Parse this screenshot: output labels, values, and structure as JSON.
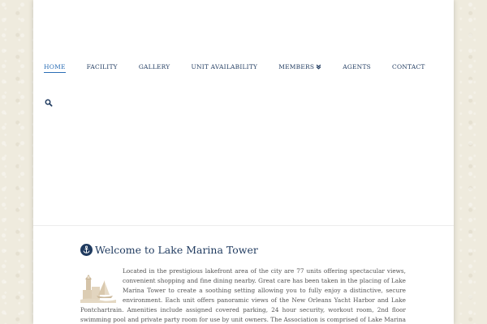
{
  "nav": {
    "items": [
      {
        "label": "HOME",
        "active": true
      },
      {
        "label": "FACILITY"
      },
      {
        "label": "GALLERY"
      },
      {
        "label": "UNIT AVAILABILITY"
      },
      {
        "label": "MEMBERS",
        "has_dropdown": true
      },
      {
        "label": "AGENTS"
      },
      {
        "label": "CONTACT"
      }
    ],
    "search_icon": "search-icon"
  },
  "welcome": {
    "title": "Welcome to Lake Marina Tower",
    "icon": "anchor-icon",
    "image": "lighthouse-logo",
    "body": "Located in the prestigious lakefront area of the city are 77 units offering spectacular views, convenient shopping and fine dining nearby. Great care has been taken in the placing of Lake Marina Tower to create a soothing setting allowing you to fully enjoy a distinctive, secure environment. Each unit offers panoramic views of the New Orleans Yacht Harbor and Lake Pontchartrain. Amenities include assigned covered parking, 24 hour security, workout room, 2nd floor swimming pool and private party room for use by unit owners. The Association is comprised of Lake Marina Tower owners who annually elect a Board of Directors"
  },
  "colors": {
    "navy": "#1f3a5f",
    "accent": "#2a6db5",
    "body_text": "#555555",
    "background": "#efebde"
  }
}
